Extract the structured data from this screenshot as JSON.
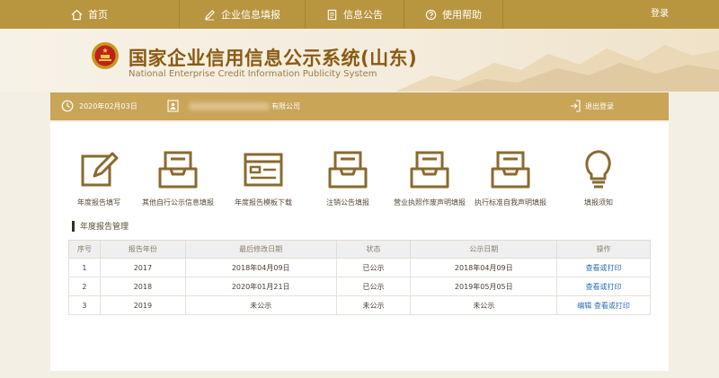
{
  "nav": {
    "home": "首页",
    "report": "企业信息填报",
    "notice": "信息公告",
    "help": "使用帮助",
    "login": "登录"
  },
  "banner": {
    "title_cn": "国家企业信用信息公示系统(山东)",
    "title_en": "National Enterprise Credit Information Publicity System"
  },
  "infobar": {
    "date": "2020年02月03日",
    "company_suffix": "有限公司",
    "logout": "退出登录"
  },
  "functions": [
    {
      "label": "年度报告填写",
      "icon": "pencil-edit-icon"
    },
    {
      "label": "其他自行公示信息填报",
      "icon": "inbox-tray-icon"
    },
    {
      "label": "年度报告模板下载",
      "icon": "template-form-icon"
    },
    {
      "label": "注销公告填报",
      "icon": "inbox-tray-icon"
    },
    {
      "label": "营业执照作废声明填报",
      "icon": "inbox-tray-icon"
    },
    {
      "label": "执行标准自我声明填报",
      "icon": "inbox-tray-icon"
    },
    {
      "label": "填报须知",
      "icon": "lightbulb-icon"
    }
  ],
  "section": {
    "title": "年度报告管理"
  },
  "table": {
    "headers": [
      "序号",
      "报告年份",
      "最后修改日期",
      "状态",
      "公示日期",
      "操作"
    ],
    "rows": [
      {
        "no": "1",
        "year": "2017",
        "modified": "2018年04月09日",
        "status": "已公示",
        "published": "2018年04月09日",
        "edit": "",
        "action": "查看或打印"
      },
      {
        "no": "2",
        "year": "2018",
        "modified": "2020年01月21日",
        "status": "已公示",
        "published": "2019年05月05日",
        "edit": "",
        "action": "查看或打印"
      },
      {
        "no": "3",
        "year": "2019",
        "modified": "未公示",
        "status": "未公示",
        "published": "未公示",
        "edit": "编辑",
        "action": "查看或打印"
      }
    ]
  },
  "colors": {
    "nav_gold": "#b8953f",
    "bar_gold": "#c9a558",
    "icon_brown": "#8a6a2e",
    "link_blue": "#2b6cb8",
    "title_brown": "#8a5a12"
  }
}
